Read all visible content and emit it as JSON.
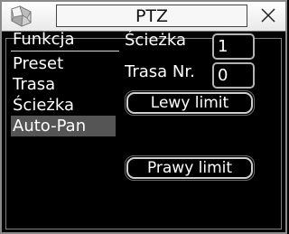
{
  "window": {
    "title": "PTZ"
  },
  "menu": {
    "title": "Funkcja",
    "items": [
      {
        "label": "Preset",
        "selected": false
      },
      {
        "label": "Trasa",
        "selected": false
      },
      {
        "label": "Ścieżka",
        "selected": false
      },
      {
        "label": "Auto-Pan",
        "selected": true
      }
    ]
  },
  "fields": {
    "path_label": "Ścieżka",
    "path_value": "1",
    "tour_label": "Trasa Nr.",
    "tour_value": "0"
  },
  "buttons": {
    "left_limit": "Lewy limit",
    "right_limit": "Prawy limit"
  },
  "icons": {
    "logo": "dvr-logo-icon",
    "close": "close-icon"
  }
}
